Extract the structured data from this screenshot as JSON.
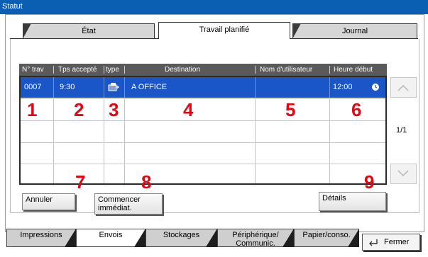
{
  "window_title": "Statut",
  "tabs_top": [
    "État",
    "Travail planifié",
    "Journal"
  ],
  "columns": [
    "N° trav",
    "Tps accepté",
    "type",
    "Destination",
    "Nom d'utilisateur",
    "Heure début"
  ],
  "selected_row": {
    "job_no": "0007",
    "accepted_time": "9:30",
    "type_icon": "fax-send-icon",
    "destination": "A OFFICE",
    "user": "",
    "start_time": "12:00",
    "start_icon": "clock-icon"
  },
  "callouts": [
    "1",
    "2",
    "3",
    "4",
    "5",
    "6",
    "7",
    "8",
    "9"
  ],
  "page_indicator": "1/1",
  "buttons": {
    "cancel": "Annuler",
    "start_now_line1": "Commencer",
    "start_now_line2": "immédiat.",
    "details": "Détails"
  },
  "bottom_tabs": [
    "Impressions",
    "Envois",
    "Stockages",
    "Périphérique/",
    "Communic.",
    "Papier/conso."
  ],
  "close_label": "Fermer",
  "colors": {
    "title_bar": "#0b5fb3",
    "selected_row": "#1a56c8",
    "callout": "#e30613"
  }
}
